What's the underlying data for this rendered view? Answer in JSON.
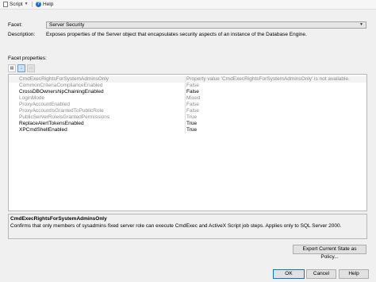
{
  "toolbar": {
    "script_label": "Script",
    "help_label": "Help"
  },
  "facet": {
    "label": "Facet:",
    "selected": "Server Security",
    "description_label": "Description:",
    "description": "Exposes properties of the Server object that encapsulates security aspects of an instance of the Database Engine."
  },
  "facet_properties_label": "Facet properties:",
  "properties": [
    {
      "name": "CmdExecRightsForSystemAdminsOnly",
      "value": "Property value 'CmdExecRightsForSystemAdminsOnly' is not available.",
      "enabled": false,
      "selected": true
    },
    {
      "name": "CommonCriteriaComplianceEnabled",
      "value": "False",
      "enabled": false
    },
    {
      "name": "CrossDBOwnershipChainingEnabled",
      "value": "False",
      "enabled": true
    },
    {
      "name": "LoginMode",
      "value": "Mixed",
      "enabled": false
    },
    {
      "name": "ProxyAccountEnabled",
      "value": "False",
      "enabled": false
    },
    {
      "name": "ProxyAccountIsGrantedToPublicRole",
      "value": "False",
      "enabled": false
    },
    {
      "name": "PublicServerRoleIsGrantedPermissions",
      "value": "True",
      "enabled": false
    },
    {
      "name": "ReplaceAlertTokensEnabled",
      "value": "True",
      "enabled": true
    },
    {
      "name": "XPCmdShellEnabled",
      "value": "True",
      "enabled": true
    }
  ],
  "description_panel": {
    "title": "CmdExecRightsForSystemAdminsOnly",
    "text": "Confirms that only members of sysadmins fixed server role can execute CmdExec and ActiveX Script job steps. Applies only to SQL Server 2000."
  },
  "buttons": {
    "export": "Export Current State as Policy...",
    "ok": "OK",
    "cancel": "Cancel",
    "help": "Help"
  }
}
